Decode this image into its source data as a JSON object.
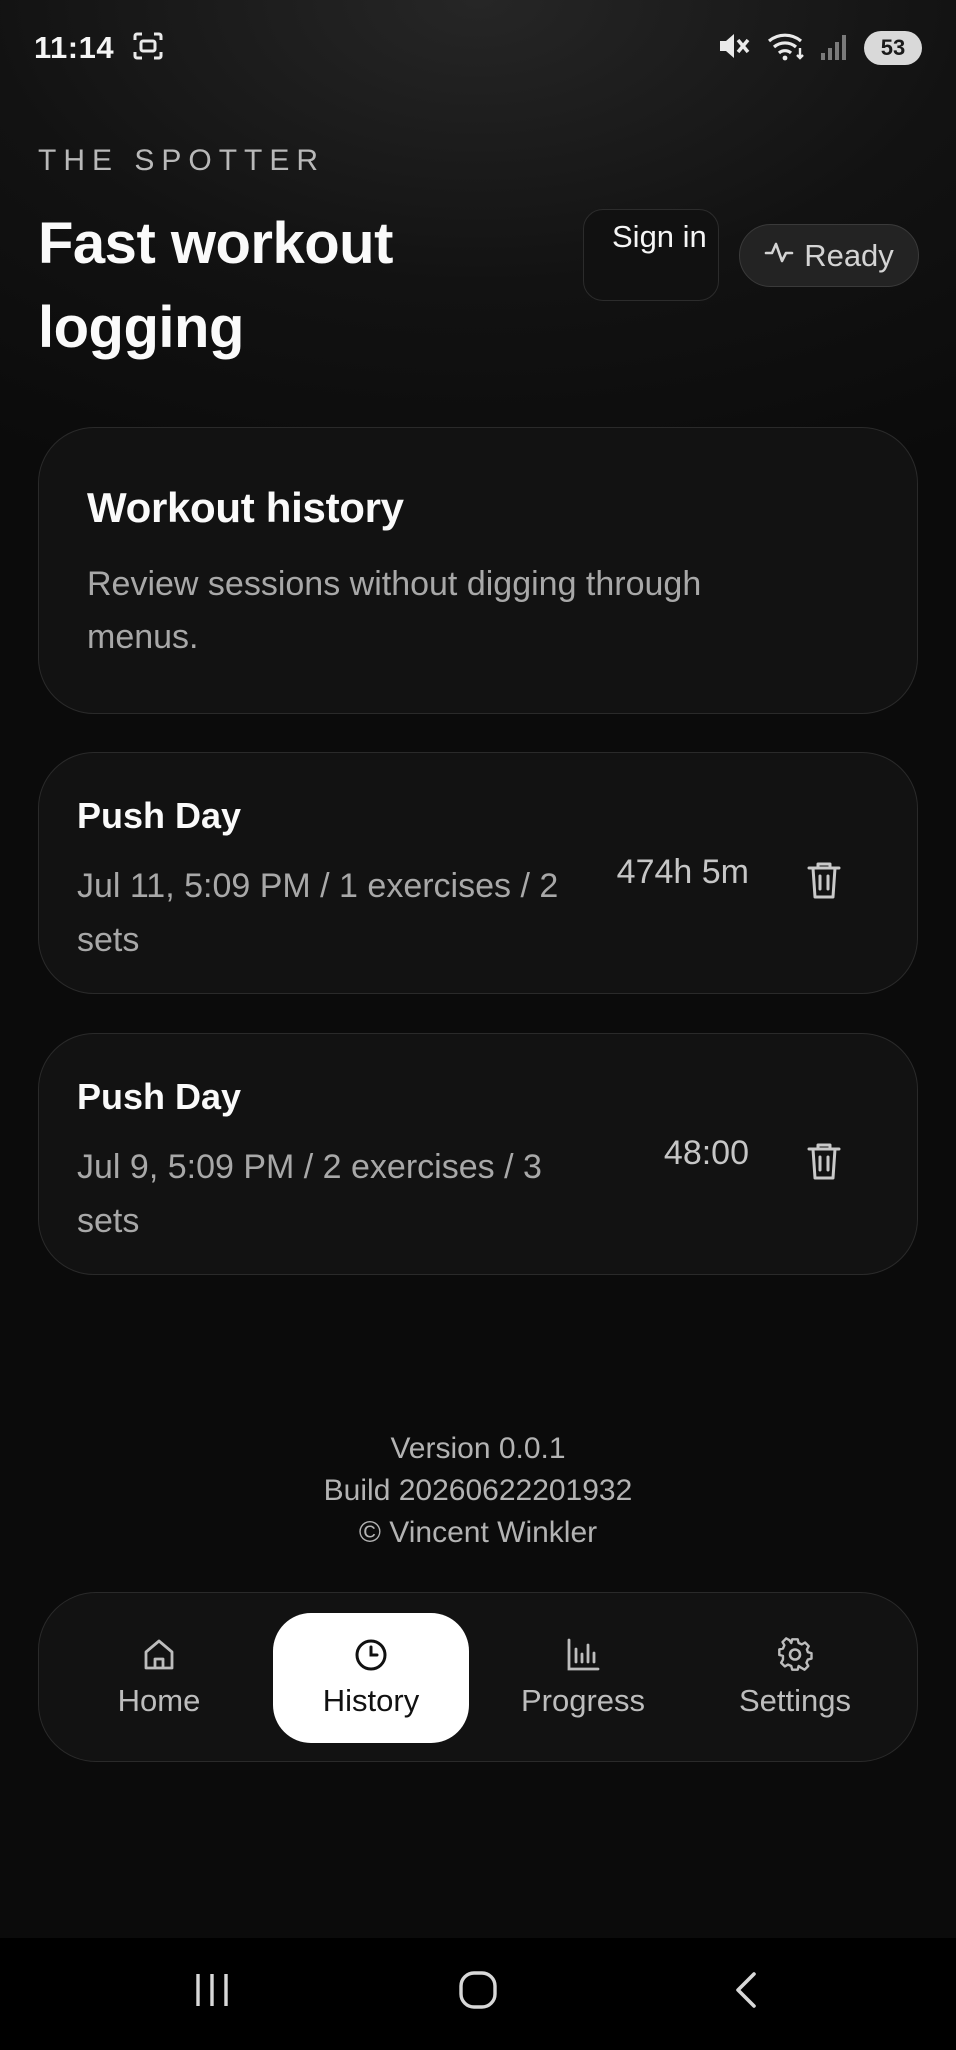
{
  "status_bar": {
    "time": "11:14",
    "battery": "53",
    "icons": [
      "screenshot-icon",
      "mute-icon",
      "wifi-icon",
      "signal-icon"
    ]
  },
  "header": {
    "brand": "THE SPOTTER",
    "title": "Fast workout logging",
    "sign_in_label": "Sign in",
    "status_label": "Ready"
  },
  "history_intro": {
    "title": "Workout history",
    "description": "Review sessions without digging through menus."
  },
  "sessions": [
    {
      "title": "Push Day",
      "meta": "Jul 11, 5:09 PM / 1 exercises / 2 sets",
      "duration": "474h 5m"
    },
    {
      "title": "Push Day",
      "meta": "Jul 9, 5:09 PM / 2 exercises / 3 sets",
      "duration": "48:00"
    }
  ],
  "footer": {
    "version": "Version 0.0.1",
    "build": "Build 20260622201932",
    "copyright": "© Vincent Winkler"
  },
  "nav": {
    "items": [
      {
        "label": "Home",
        "icon": "home-icon"
      },
      {
        "label": "History",
        "icon": "clock-icon",
        "active": true
      },
      {
        "label": "Progress",
        "icon": "bar-chart-icon"
      },
      {
        "label": "Settings",
        "icon": "gear-icon"
      }
    ]
  },
  "colors": {
    "background": "#0b0b0b",
    "card": "#121212",
    "active_nav": "#ffffff",
    "muted_text": "#a8a8a8"
  }
}
